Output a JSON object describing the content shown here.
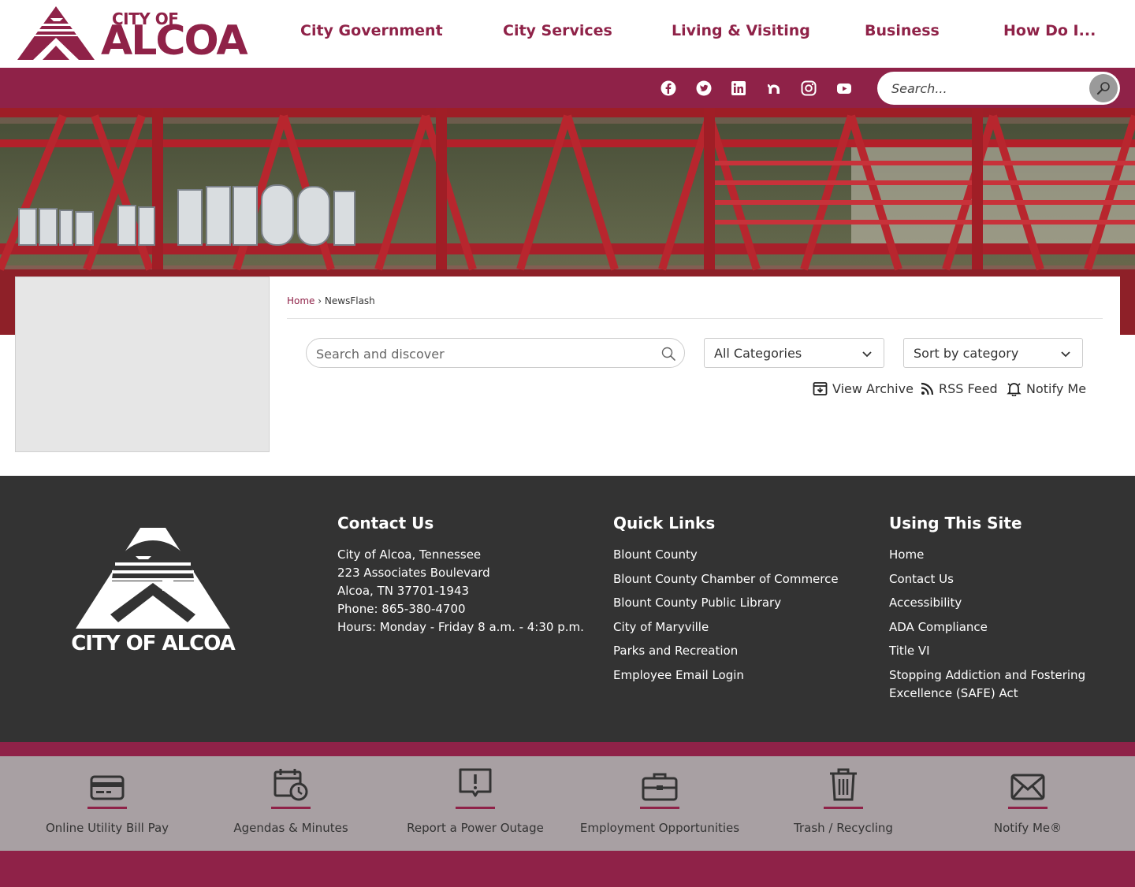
{
  "header": {
    "logo": {
      "line1": "CITY OF",
      "line2": "ALCOA"
    },
    "nav": [
      "City Government",
      "City Services",
      "Living & Visiting",
      "Business",
      "How Do I..."
    ]
  },
  "social": {
    "icons": [
      "facebook-icon",
      "twitter-icon",
      "linkedin-icon",
      "nextdoor-icon",
      "instagram-icon",
      "youtube-icon"
    ],
    "search_placeholder": "Search..."
  },
  "breadcrumb": {
    "home": "Home",
    "separator": "›",
    "current": "NewsFlash"
  },
  "newsflash": {
    "search_placeholder": "Search and discover",
    "category": "All Categories",
    "sort": "Sort by category",
    "actions": {
      "archive": "View Archive",
      "rss": "RSS Feed",
      "notify": "Notify Me"
    }
  },
  "footer": {
    "logo_text": "CITY OF ALCOA",
    "contact": {
      "title": "Contact Us",
      "lines": [
        "City of Alcoa, Tennessee",
        "223 Associates Boulevard",
        "Alcoa, TN 37701-1943",
        "Phone: 865-380-4700",
        "Hours: Monday - Friday 8 a.m. - 4:30 p.m."
      ]
    },
    "quick_links": {
      "title": "Quick Links",
      "items": [
        "Blount County",
        "Blount County Chamber of Commerce",
        "Blount County Public Library",
        "City of Maryville",
        "Parks and Recreation",
        "Employee Email Login"
      ]
    },
    "using_site": {
      "title": "Using This Site",
      "items": [
        "Home",
        "Contact Us",
        "Accessibility",
        "ADA Compliance",
        "Title VI",
        "Stopping Addiction and Fostering",
        "Excellence (SAFE) Act"
      ]
    }
  },
  "quick_tiles": [
    {
      "label": "Online Utility Bill Pay",
      "icon": "credit-card-icon"
    },
    {
      "label": "Agendas & Minutes",
      "icon": "calendar-clock-icon"
    },
    {
      "label": "Report a Power Outage",
      "icon": "alert-message-icon"
    },
    {
      "label": "Employment Opportunities",
      "icon": "briefcase-icon"
    },
    {
      "label": "Trash / Recycling",
      "icon": "trash-icon"
    },
    {
      "label": "Notify Me®",
      "icon": "envelope-icon"
    }
  ],
  "colors": {
    "brand": "#8f2248",
    "footer_bg": "#333333",
    "tile_bg": "#a8a0a3"
  }
}
